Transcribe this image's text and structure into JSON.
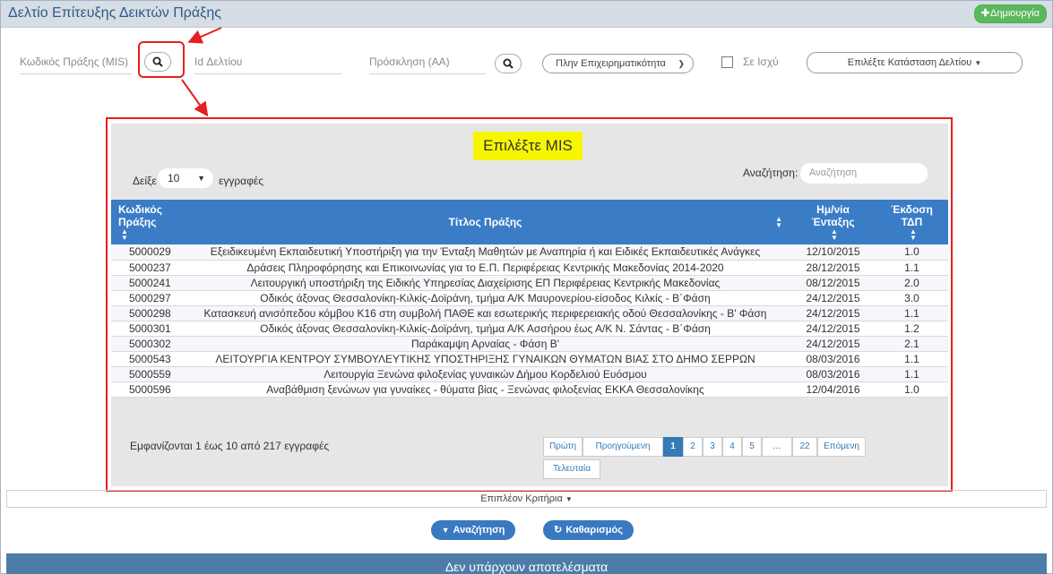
{
  "header": {
    "title": "Δελτίο Επίτευξης Δεικτών Πράξης",
    "create_label": "Δημιουργία",
    "create_icon": "plus-icon"
  },
  "filters": {
    "mis_label": "Κωδικός Πράξης (MIS)",
    "id_label": "Id Δελτίου",
    "invitation_label": "Πρόσκληση (ΑΑ)",
    "program_select": "Πληv Επιχειρηματικότητα",
    "in_force_label": "Σε Ισχύ",
    "status_select": "Επιλέξτε Κατάσταση Δελτίου"
  },
  "modal": {
    "title": "Επιλέξτε MIS",
    "show_label": "Δείξε",
    "page_length": "10",
    "records_label": "εγγραφές",
    "search_label": "Αναζήτηση:",
    "search_placeholder": "Αναζήτηση",
    "columns": [
      "Κωδικός Πράξης",
      "Τίτλος Πράξης",
      "Ημ/νία Ένταξης",
      "Έκδοση ΤΔΠ"
    ],
    "rows": [
      {
        "code": "5000029",
        "title": "Εξειδικευμένη Εκπαιδευτική Υποστήριξη για την Ένταξη Μαθητών με Αναπηρία ή και Ειδικές Εκπαιδευτικές Ανάγκες",
        "date": "12/10/2015",
        "version": "1.0"
      },
      {
        "code": "5000237",
        "title": "Δράσεις Πληροφόρησης και Επικοινωνίας για το Ε.Π. Περιφέρειας Κεντρικής Μακεδονίας 2014-2020",
        "date": "28/12/2015",
        "version": "1.1"
      },
      {
        "code": "5000241",
        "title": "Λειτουργική υποστήριξη της Ειδικής Υπηρεσίας Διαχείρισης ΕΠ Περιφέρειας Κεντρικής Μακεδονίας",
        "date": "08/12/2015",
        "version": "2.0"
      },
      {
        "code": "5000297",
        "title": "Οδικός άξονας Θεσσαλονίκη-Κιλκίς-Δοϊράνη, τμήμα Α/Κ Μαυρονερίου-είσοδος Κιλκίς - Β΄Φάση",
        "date": "24/12/2015",
        "version": "3.0"
      },
      {
        "code": "5000298",
        "title": "Κατασκευή ανισόπεδου κόμβου Κ16 στη συμβολή ΠΑΘΕ και εσωτερικής περιφερειακής οδού Θεσσαλονίκης - Β' Φάση",
        "date": "24/12/2015",
        "version": "1.1"
      },
      {
        "code": "5000301",
        "title": "Οδικός άξονας Θεσσαλονίκη-Κιλκίς-Δοϊράνη, τμήμα Α/Κ Ασσήρου έως Α/Κ Ν. Σάντας - Β΄Φάση",
        "date": "24/12/2015",
        "version": "1.2"
      },
      {
        "code": "5000302",
        "title": "Παράκαμψη Αρναίας - Φάση Β'",
        "date": "24/12/2015",
        "version": "2.1"
      },
      {
        "code": "5000543",
        "title": "ΛΕΙΤΟΥΡΓΙΑ ΚΕΝΤΡΟΥ ΣΥΜΒΟΥΛΕΥΤΙΚΗΣ ΥΠΟΣΤΗΡΙΞΗΣ ΓΥΝΑΙΚΩΝ ΘΥΜΑΤΩΝ ΒΙΑΣ ΣΤΟ ΔΗΜΟ ΣΕΡΡΩΝ",
        "date": "08/03/2016",
        "version": "1.1"
      },
      {
        "code": "5000559",
        "title": "Λειτουργία Ξενώνα φιλοξενίας γυναικών Δήμου Κορδελιού Ευόσμου",
        "date": "08/03/2016",
        "version": "1.1"
      },
      {
        "code": "5000596",
        "title": "Αναβάθμιση ξενώνων για γυναίκες - θύματα βίας - Ξενώνας φιλοξενίας ΕΚΚΑ Θεσσαλονίκης",
        "date": "12/04/2016",
        "version": "1.0"
      }
    ],
    "info": "Εμφανίζονται 1 έως 10 από 217 εγγραφές",
    "pagination": {
      "first": "Πρώτη",
      "previous": "Προηγούμενη",
      "pages": [
        "1",
        "2",
        "3",
        "4",
        "5",
        "…",
        "22"
      ],
      "current": "1",
      "next": "Επόμενη",
      "last": "Τελευταία"
    }
  },
  "bottom": {
    "more_criteria": "Επιπλέον Κριτήρια",
    "search_button": "Αναζήτηση",
    "clear_button": "Καθαρισμός",
    "no_results": "Δεν υπάρχουν αποτελέσματα"
  },
  "colors": {
    "accent": "#3a7cc5",
    "highlight": "#f6f600",
    "annotation": "#e41f1f",
    "success": "#5cb85c"
  }
}
